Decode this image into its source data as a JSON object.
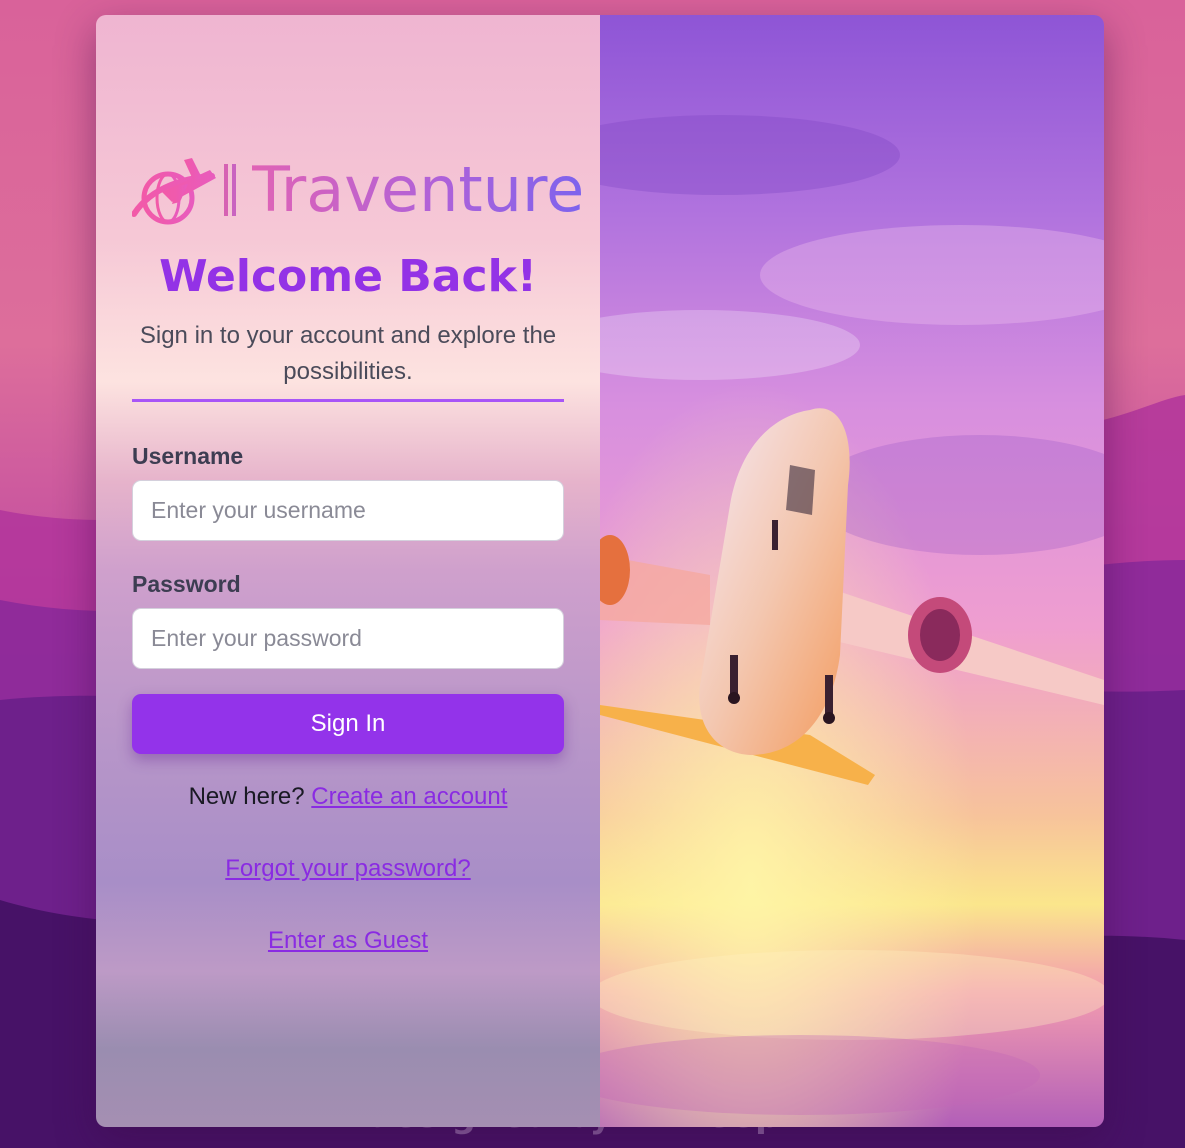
{
  "brand": {
    "name": "Traventure",
    "logo_icon": "plane-globe-icon"
  },
  "login": {
    "title": "Welcome Back!",
    "subtitle": "Sign in to your account and explore the possibilities.",
    "username_label": "Username",
    "username_placeholder": "Enter your username",
    "password_label": "Password",
    "password_placeholder": "Enter your password",
    "signin_label": "Sign In",
    "new_here_text": "New here?",
    "create_account_link": "Create an account",
    "forgot_password_link": "Forgot your password?",
    "guest_link": "Enter as Guest"
  },
  "footer": {
    "text": "designed by © freepik"
  },
  "colors": {
    "accent": "#9333ea",
    "divider": "#a855f7",
    "link": "#8a2be2"
  }
}
